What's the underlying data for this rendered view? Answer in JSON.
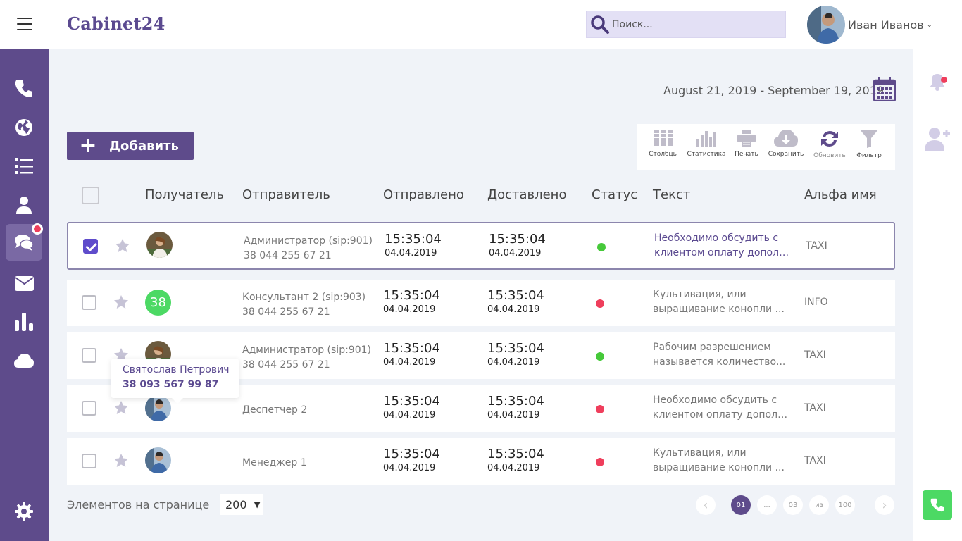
{
  "app": {
    "logo": "Cabinet24"
  },
  "search": {
    "placeholder": "Поиск..."
  },
  "user": {
    "name": "Иван Иванов"
  },
  "date_range": "August 21, 2019 - September 19, 2019",
  "add_button": "Добавить",
  "toolbar": {
    "columns": "Столбцы",
    "statistics": "Статистика",
    "print": "Печать",
    "save": "Сохранить",
    "refresh": "Обновить",
    "filter": "Фильтр"
  },
  "table": {
    "headers": {
      "recipient": "Получатель",
      "sender": "Отправитель",
      "sent": "Отправлено",
      "delivered": "Доставлено",
      "status": "Статус",
      "text": "Текст",
      "alpha": "Альфа имя"
    },
    "rows": [
      {
        "checked": true,
        "avatar": "photo-female",
        "sender_name": "Администратор (sip:901)",
        "sender_phone": "38 044 255 67 21",
        "sent_time": "15:35:04",
        "sent_date": "04.04.2019",
        "delivered_time": "15:35:04",
        "delivered_date": "04.04.2019",
        "status_color": "#46c93a",
        "text": "Необходимо обсудить с клиентом оплату дополн...",
        "text_line1": "Необходимо обсудить с",
        "text_line2": "клиентом оплату дополн...",
        "alpha": "TAXI"
      },
      {
        "checked": false,
        "avatar_number": "38",
        "sender_name": "Консультант 2 (sip:903)",
        "sender_phone": "38 044 255 67 21",
        "sent_time": "15:35:04",
        "sent_date": "04.04.2019",
        "delivered_time": "15:35:04",
        "delivered_date": "04.04.2019",
        "status_color": "#ef3e5c",
        "text_line1": "Культивация, или",
        "text_line2": "выращивание конопли ...",
        "alpha": "INFO"
      },
      {
        "checked": false,
        "avatar": "photo-female",
        "sender_name": "Администратор (sip:901)",
        "sender_phone": "38 044 255 67 21",
        "sent_time": "15:35:04",
        "sent_date": "04.04.2019",
        "delivered_time": "15:35:04",
        "delivered_date": "04.04.2019",
        "status_color": "#46c93a",
        "text_line1": "Рабочим разрешением",
        "text_line2": "называется количество...",
        "alpha": "TAXI"
      },
      {
        "checked": false,
        "avatar": "photo-male",
        "sender_name": "Деспетчер 2",
        "sent_time": "15:35:04",
        "sent_date": "04.04.2019",
        "delivered_time": "15:35:04",
        "delivered_date": "04.04.2019",
        "status_color": "#ef3e5c",
        "text_line1": "Необходимо обсудить с",
        "text_line2": "клиентом оплату дополн ...",
        "alpha": "TAXI"
      },
      {
        "checked": false,
        "avatar": "photo-male",
        "sender_name": "Менеджер 1",
        "sent_time": "15:35:04",
        "sent_date": "04.04.2019",
        "delivered_time": "15:35:04",
        "delivered_date": "04.04.2019",
        "status_color": "#ef3e5c",
        "text_line1": "Культивация, или",
        "text_line2": "выращивание конопли ...",
        "alpha": "TAXI"
      }
    ]
  },
  "tooltip": {
    "name": "Святослав Петрович",
    "phone": "38 093 567 99 87"
  },
  "pagination": {
    "per_page_label": "Элементов на странице",
    "per_page_value": "200",
    "pages": [
      "01",
      "...",
      "03",
      "из",
      "100"
    ],
    "current": "01"
  },
  "colors": {
    "sidebar": "#5e4b8b",
    "accent": "#5b4a90",
    "status_ok": "#46c93a",
    "status_fail": "#ef3e5c",
    "call_button": "#4cd964"
  }
}
